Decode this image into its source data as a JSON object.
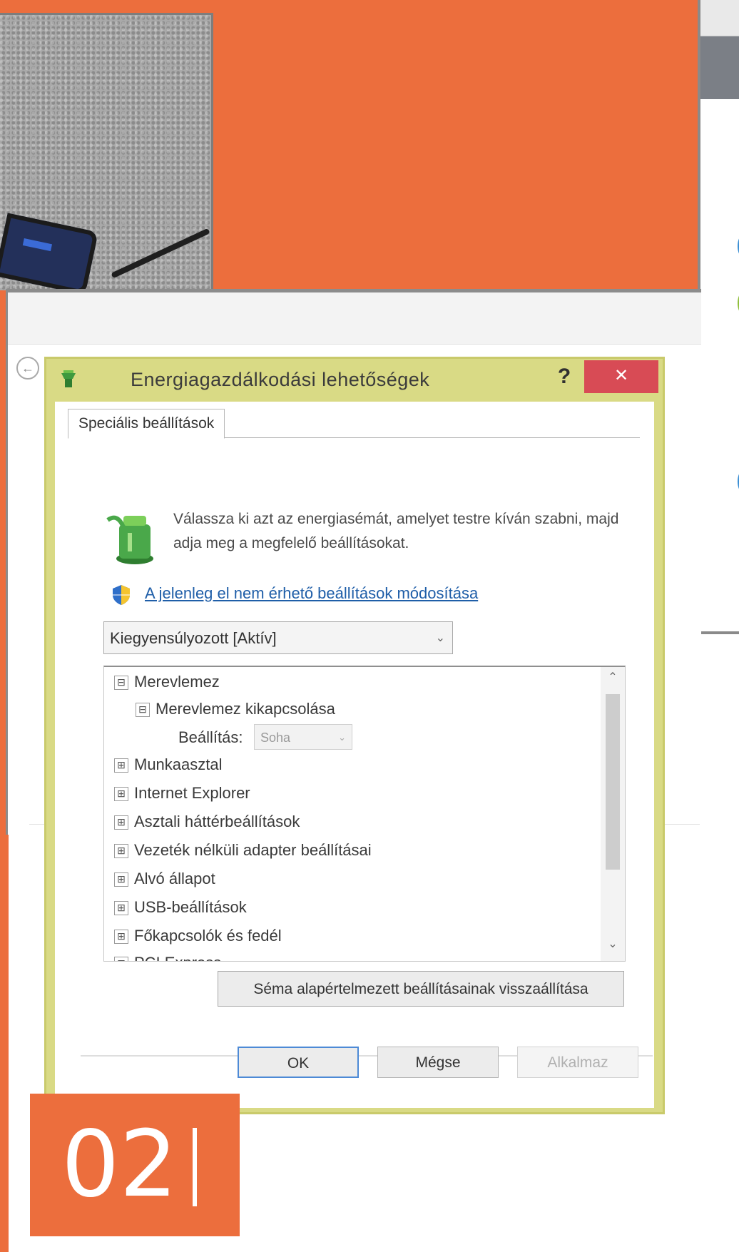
{
  "dialog": {
    "title": "Energiagazdálkodási lehetőségek",
    "help_label": "?",
    "close_label": "✕",
    "tab_label": "Speciális beállítások",
    "intro_text": "Válassza ki azt az energiasémát, amelyet testre kíván szabni, majd adja meg a megfelelő beállításokat.",
    "settings_link": "A jelenleg el nem érhető beállítások módosítása",
    "plan_select_value": "Kiegyensúlyozott [Aktív]",
    "tree": {
      "items": [
        {
          "toggle": "⊟",
          "label": "Merevlemez"
        },
        {
          "toggle": "⊟",
          "label": "Merevlemez kikapcsolása"
        },
        {
          "label": "Beállítás:"
        },
        {
          "toggle": "⊞",
          "label": "Munkaasztal"
        },
        {
          "toggle": "⊞",
          "label": "Internet Explorer"
        },
        {
          "toggle": "⊞",
          "label": "Asztali háttérbeállítások"
        },
        {
          "toggle": "⊞",
          "label": "Vezeték nélküli adapter beállításai"
        },
        {
          "toggle": "⊞",
          "label": "Alvó állapot"
        },
        {
          "toggle": "⊞",
          "label": "USB-beállítások"
        },
        {
          "toggle": "⊞",
          "label": "Főkapcsolók és fedél"
        },
        {
          "toggle": "⊞",
          "label": "PCI Express"
        }
      ],
      "sub_select_value": "Soha"
    },
    "restore_button": "Séma alapértelmezett beállításainak visszaállítása",
    "ok_button": "OK",
    "cancel_button": "Mégse",
    "apply_button": "Alkalmaz"
  },
  "step_badge": "02",
  "colors": {
    "accent_orange": "#ec6e3d",
    "dialog_frame": "#d9da85",
    "close_red": "#d84b55",
    "link_blue": "#1f5ea8"
  }
}
